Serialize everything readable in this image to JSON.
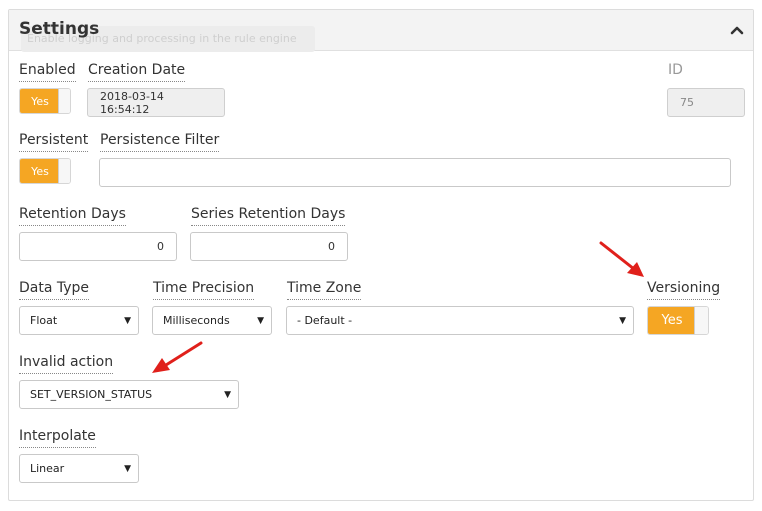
{
  "panel": {
    "title": "Settings",
    "ghost_tooltip": "Enable logging and processing in the rule engine"
  },
  "fields": {
    "enabled": {
      "label": "Enabled",
      "value": "Yes"
    },
    "creation_date": {
      "label": "Creation Date",
      "value": "2018-03-14 16:54:12"
    },
    "id": {
      "label": "ID",
      "value": "75"
    },
    "persistent": {
      "label": "Persistent",
      "value": "Yes"
    },
    "persistence_filter": {
      "label": "Persistence Filter",
      "value": ""
    },
    "retention_days": {
      "label": "Retention Days",
      "value": "0"
    },
    "series_retention_days": {
      "label": "Series Retention Days",
      "value": "0"
    },
    "data_type": {
      "label": "Data Type",
      "value": "Float"
    },
    "time_precision": {
      "label": "Time Precision",
      "value": "Milliseconds"
    },
    "time_zone": {
      "label": "Time Zone",
      "value": "- Default -"
    },
    "versioning": {
      "label": "Versioning",
      "value": "Yes"
    },
    "invalid_action": {
      "label": "Invalid action",
      "value": "SET_VERSION_STATUS"
    },
    "interpolate": {
      "label": "Interpolate",
      "value": "Linear"
    }
  },
  "colors": {
    "accent": "#f5a623",
    "annotation_arrow": "#e0201b"
  }
}
